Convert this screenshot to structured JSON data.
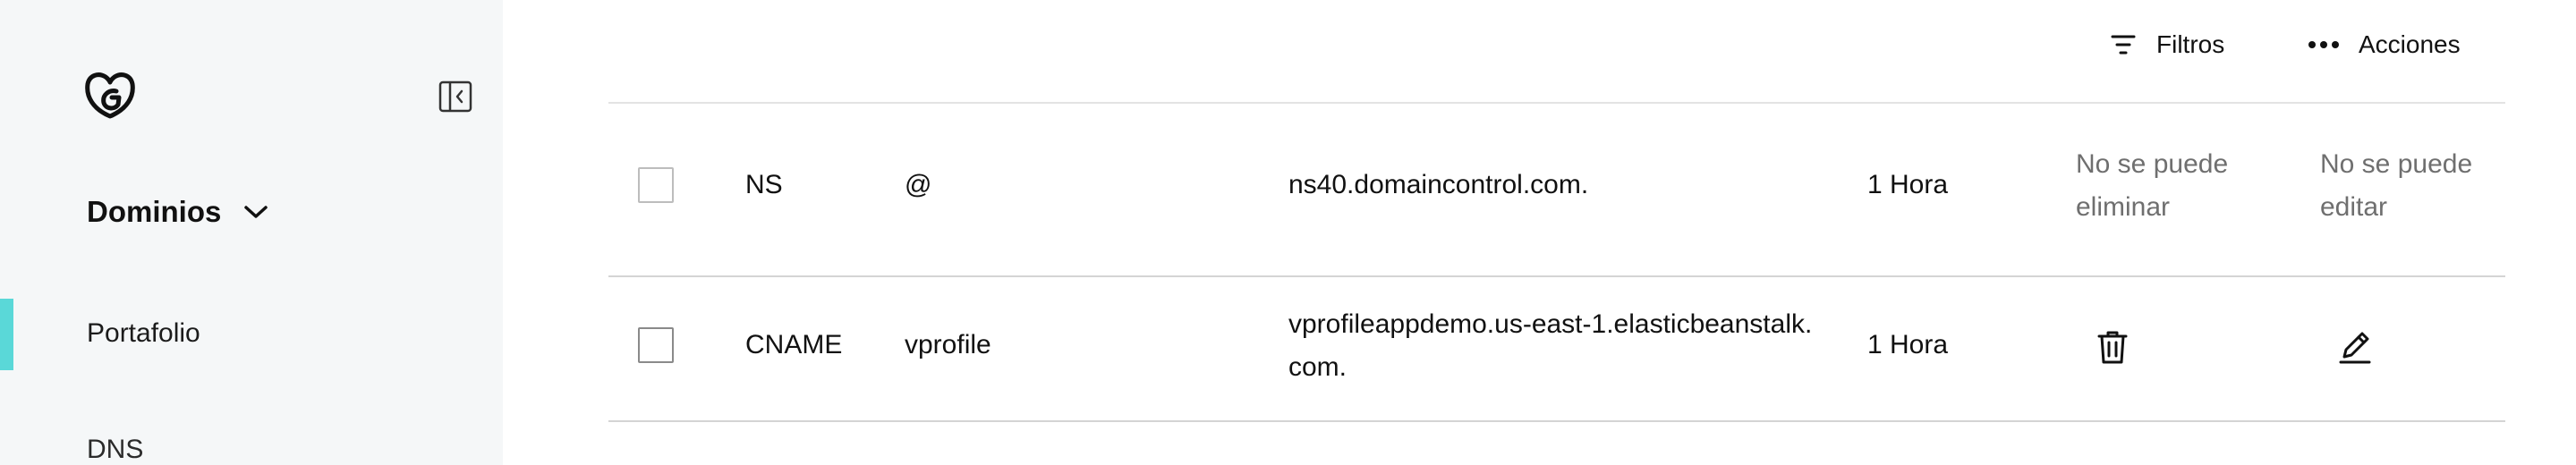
{
  "sidebar": {
    "group_label": "Dominios",
    "items": [
      {
        "label": "Portafolio",
        "active": true
      },
      {
        "label": "DNS",
        "active": false
      }
    ]
  },
  "toolbar": {
    "filters_label": "Filtros",
    "actions_label": "Acciones"
  },
  "records": [
    {
      "type": "NS",
      "name": "@",
      "value": "ns40.domaincontrol.com.",
      "ttl": "1 Hora",
      "delete_text": "No se puede eliminar",
      "edit_text": "No se puede editar"
    },
    {
      "type": "CNAME",
      "name": "vprofile",
      "value": "vprofileappdemo.us-east-1.elasticbeanstalk.com.",
      "ttl": "1 Hora"
    }
  ],
  "colors": {
    "sidebar_bg": "#f5f7f8",
    "active_indicator": "#5ad8d8",
    "divider": "#d4d4d4",
    "muted_text": "#6f6f6f"
  },
  "icons": {
    "logo": "godaddy-logo-icon",
    "collapse": "sidebar-collapse-icon",
    "chevron": "chevron-down-icon",
    "filter": "filter-icon",
    "more": "more-horizontal-icon",
    "delete": "trash-icon",
    "edit": "pencil-icon"
  }
}
